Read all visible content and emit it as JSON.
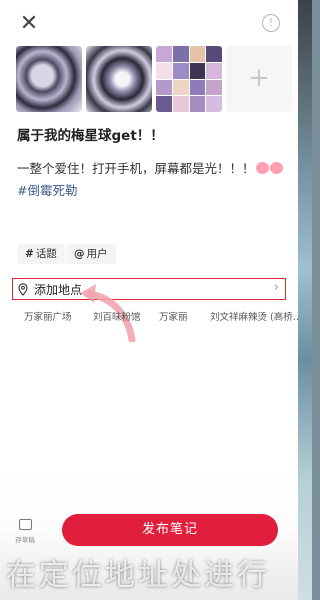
{
  "header": {
    "close_glyph": "✕",
    "info_glyph": "!"
  },
  "photos": {
    "add_glyph": "+"
  },
  "note": {
    "title": "属于我的梅星球get！！",
    "body": "一整个爱住！打开手机，屏幕都是光！！！",
    "hashtag": "#倒霉死勒"
  },
  "chips": {
    "topic_symbol": "#",
    "topic_label": "话题",
    "user_symbol": "@",
    "user_label": "用户"
  },
  "location": {
    "label": "添加地点",
    "chevron": "›",
    "suggestions": [
      "万家丽广场",
      "刘百味粉馆",
      "万家丽",
      "刘文祥麻辣烫 (高桥…"
    ]
  },
  "footer": {
    "draft_label": "存草稿",
    "publish_label": "发布笔记"
  },
  "caption": {
    "text": "在定位地址处进行"
  },
  "colors": {
    "accent": "#e21e3d",
    "highlight_box": "#e0262f",
    "hashtag": "#3b5b8f"
  }
}
